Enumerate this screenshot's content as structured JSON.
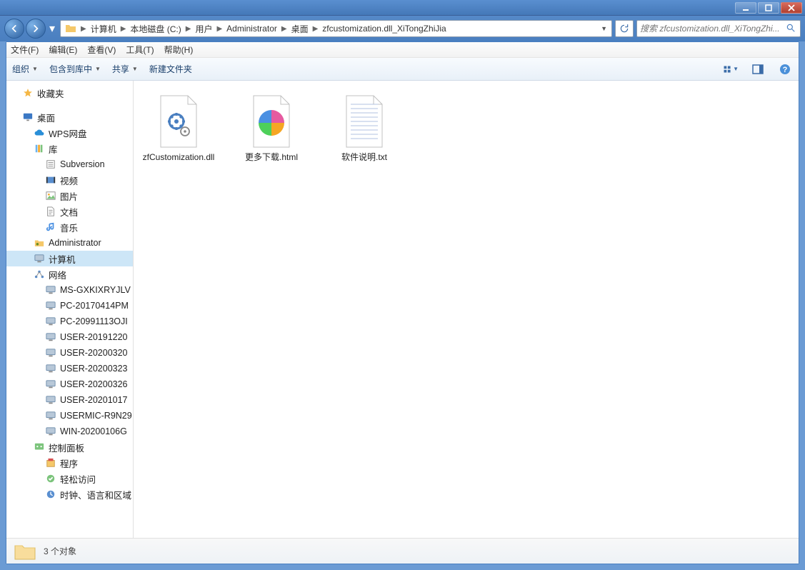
{
  "window_controls": {
    "min": "_",
    "max": "□",
    "close": "×"
  },
  "breadcrumb": {
    "items": [
      "计算机",
      "本地磁盘 (C:)",
      "用户",
      "Administrator",
      "桌面",
      "zfcustomization.dll_XiTongZhiJia"
    ]
  },
  "search": {
    "placeholder": "搜索 zfcustomization.dll_XiTongZhi..."
  },
  "menubar": [
    "文件(F)",
    "编辑(E)",
    "查看(V)",
    "工具(T)",
    "帮助(H)"
  ],
  "toolbar": {
    "organize": "组织",
    "include": "包含到库中",
    "share": "共享",
    "newfolder": "新建文件夹"
  },
  "sidebar": {
    "favorites": "收藏夹",
    "desktop": "桌面",
    "wps": "WPS网盘",
    "library": "库",
    "lib_items": [
      "Subversion",
      "视频",
      "图片",
      "文档",
      "音乐"
    ],
    "admin": "Administrator",
    "computer": "计算机",
    "network": "网络",
    "net_items": [
      "MS-GXKIXRYJLV",
      "PC-20170414PM",
      "PC-20991113OJI",
      "USER-20191220",
      "USER-20200320",
      "USER-20200323",
      "USER-20200326",
      "USER-20201017",
      "USERMIC-R9N29",
      "WIN-20200106G"
    ],
    "controlpanel": "控制面板",
    "cp_items": [
      "程序",
      "轻松访问",
      "时钟、语言和区域"
    ]
  },
  "files": [
    {
      "name": "zfCustomization.dll",
      "type": "dll"
    },
    {
      "name": "更多下载.html",
      "type": "html"
    },
    {
      "name": "软件说明.txt",
      "type": "txt"
    }
  ],
  "statusbar": {
    "text": "3 个对象"
  }
}
